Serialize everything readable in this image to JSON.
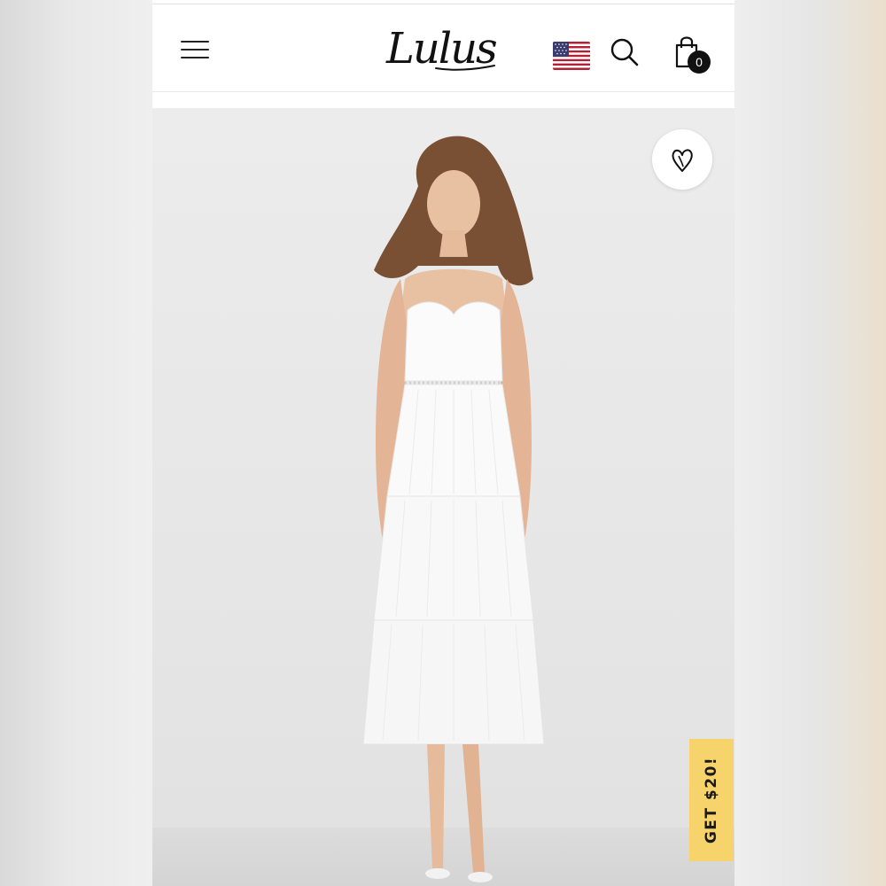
{
  "header": {
    "logo_text": "Lulus",
    "menu_icon": "hamburger-menu-icon",
    "region_flag": "us-flag-icon",
    "search_icon": "search-icon",
    "bag_icon": "shopping-bag-icon",
    "bag_count": "0"
  },
  "product": {
    "image": "model-in-white-tiered-midi-dress",
    "wishlist_icon": "heart-icon"
  },
  "promo": {
    "label": "GET $20!",
    "color": "#f7d36b"
  },
  "colors": {
    "brand_text": "#111111",
    "image_background": "#e8e8e8"
  }
}
